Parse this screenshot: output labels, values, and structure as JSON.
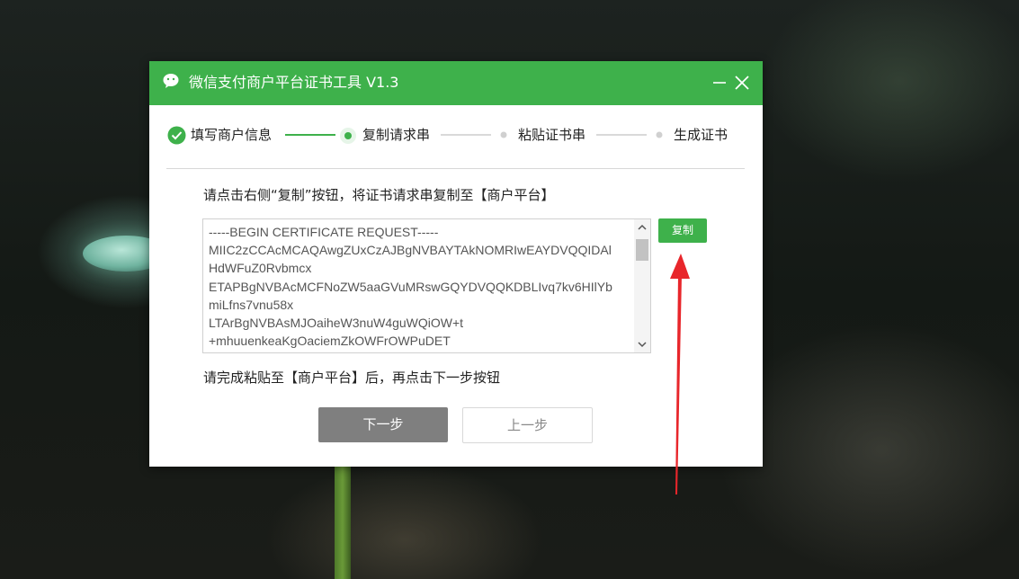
{
  "window": {
    "title": "微信支付商户平台证书工具 V1.3",
    "accent_color": "#3eb14b",
    "logo_icon": "wechat-logo-icon",
    "minimize_icon": "minimize-icon",
    "close_icon": "close-icon"
  },
  "steps": [
    {
      "label": "填写商户信息",
      "state": "done"
    },
    {
      "label": "复制请求串",
      "state": "current"
    },
    {
      "label": "粘贴证书串",
      "state": "pending"
    },
    {
      "label": "生成证书",
      "state": "pending"
    }
  ],
  "main": {
    "instruction": "请点击右侧“复制”按钮，将证书请求串复制至【商户平台】",
    "csr_lines": [
      "-----BEGIN CERTIFICATE REQUEST-----",
      "MIIC2zCCAcMCAQAwgZUxCzAJBgNVBAYTAkNOMRIwEAYDVQQIDAl",
      "HdWFuZ0Rvbmcx",
      "ETAPBgNVBAcMCFNoZW5aaGVuMRswGQYDVQQKDBLIvq7kv6HIlYb",
      "miLfns7vnu58x",
      "LTArBgNVBAsMJOaiheW3nuW4guWQiOW+t",
      "+mhuuenkeaKgOaciemZkOWFrOWPuDET"
    ],
    "copy_label": "复制",
    "after_text": "请完成粘贴至【商户平台】后，再点击下一步按钮"
  },
  "buttons": {
    "next_label": "下一步",
    "prev_label": "上一步"
  },
  "annotation": {
    "arrow_color": "#e8262b"
  }
}
